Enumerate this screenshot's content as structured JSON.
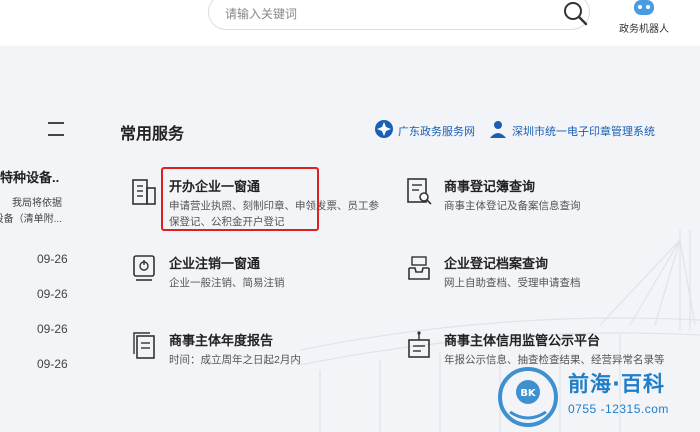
{
  "header": {
    "search_placeholder": "请输入关键词",
    "robot_label": "政务机器人"
  },
  "left_panel": {
    "title": "特种设备...",
    "desc_lines": [
      "我局将依据",
      "设备（清单附..."
    ],
    "dates": [
      "09-26",
      "09-26",
      "09-26",
      "09-26"
    ]
  },
  "services": {
    "title": "常用服务",
    "links": [
      {
        "label": "广东政务服务网"
      },
      {
        "label": "深圳市统一电子印章管理系统"
      }
    ],
    "cards": [
      {
        "title": "开办企业一窗通",
        "desc": "申请营业执照、刻制印章、申领发票、员工参保登记、公积金开户登记"
      },
      {
        "title": "商事登记簿查询",
        "desc": "商事主体登记及备案信息查询"
      },
      {
        "title": "企业注销一窗通",
        "desc": "企业一般注销、简易注销"
      },
      {
        "title": "企业登记档案查询",
        "desc": "网上自助查档、受理申请查档"
      },
      {
        "title": "商事主体年度报告",
        "desc": "时间：成立周年之日起2月内"
      },
      {
        "title": "商事主体信用监管公示平台",
        "desc": "年报公示信息、抽查检查结果、经营异常名录等"
      }
    ]
  },
  "watermark": {
    "badge": "BK",
    "name": "前海·百科",
    "phone": "0755 -12315.com"
  },
  "colors": {
    "accent": "#1a5fb4",
    "highlight": "#e02020",
    "watermark": "#1f7ec8"
  }
}
